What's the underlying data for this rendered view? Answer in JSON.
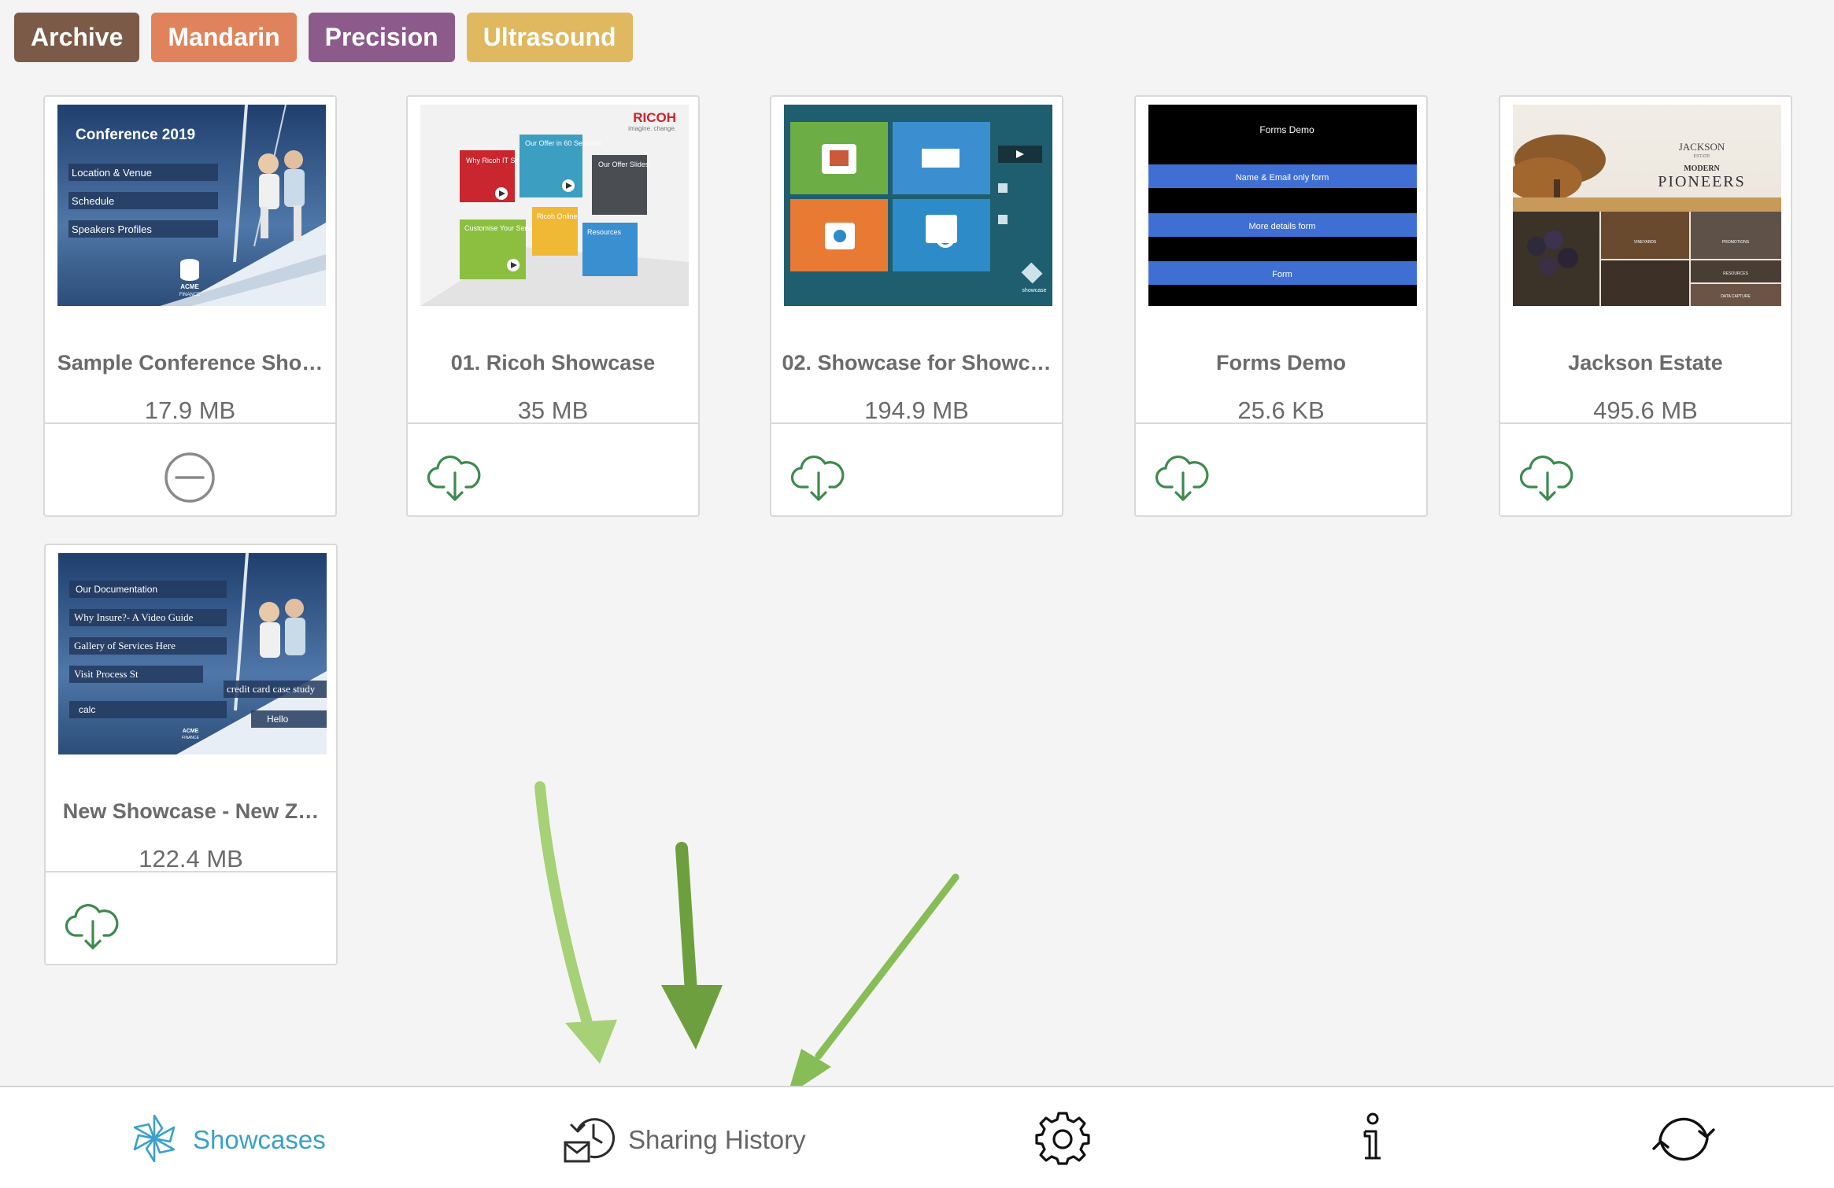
{
  "tags": [
    {
      "label": "Archive",
      "color": "#7b5b48"
    },
    {
      "label": "Mandarin",
      "color": "#e0835d"
    },
    {
      "label": "Precision",
      "color": "#8d5a8c"
    },
    {
      "label": "Ultrasound",
      "color": "#e0b85f"
    }
  ],
  "cards": [
    {
      "title": "Sample Conference Sho…",
      "size": "17.9 MB",
      "action": "remove-icon",
      "thumb": {
        "heading": "Conference 2019",
        "items": [
          "Location & Venue",
          "Schedule",
          "Speakers Profiles"
        ],
        "logo_text": [
          "ACME",
          "FINANCE"
        ]
      }
    },
    {
      "title": "01. Ricoh Showcase",
      "size": "35 MB",
      "action": "cloud-download-icon",
      "thumb": {
        "brand": "RICOH",
        "tagline": "imagine. change.",
        "tiles": [
          "Why Ricoh IT Services?",
          "Our Offer in 60 Seconds",
          "Our Offer Slides",
          "Customise Your Service",
          "Ricoh Online",
          "Resources"
        ]
      }
    },
    {
      "title": "02. Showcase for Showc…",
      "size": "194.9 MB",
      "action": "cloud-download-icon",
      "thumb": {
        "logo_text": "showcase"
      }
    },
    {
      "title": "Forms Demo",
      "size": "25.6 KB",
      "action": "cloud-download-icon",
      "thumb": {
        "heading": "Forms Demo",
        "rows": [
          "Name & Email only form",
          "More details form",
          "Form"
        ]
      }
    },
    {
      "title": "Jackson Estate",
      "size": "495.6 MB",
      "action": "cloud-download-icon",
      "thumb": {
        "brand_top": "JACKSON",
        "brand_sub": "ESTATE",
        "modern": "MODERN",
        "pioneers": "PIONEERS",
        "labels": [
          "VINEYARDS",
          "PROMOTIONS",
          "RESOURCES",
          "DATA CAPTURE"
        ]
      }
    },
    {
      "title": "New Showcase - New Z…",
      "size": "122.4 MB",
      "action": "cloud-download-icon",
      "thumb": {
        "items": [
          "Our Documentation",
          "Why Insure?- A Video Guide",
          "Gallery of Services Here",
          "Visit Process St",
          "calc"
        ],
        "extra": [
          "credit card case study",
          "Hello"
        ],
        "logo_text": [
          "ACME",
          "FINANCE"
        ]
      }
    }
  ],
  "nav": {
    "showcases": {
      "label": "Showcases",
      "icon": "showcases-flower-icon",
      "active": true
    },
    "sharing_history": {
      "label": "Sharing History",
      "icon": "sharing-history-icon"
    },
    "settings": {
      "icon": "gear-icon"
    },
    "info": {
      "icon": "info-icon"
    },
    "sync": {
      "icon": "sync-icon"
    }
  },
  "colors": {
    "accent": "#3aa0c8",
    "download_green": "#3d8a4f",
    "arrow_green": "#86bd56"
  }
}
